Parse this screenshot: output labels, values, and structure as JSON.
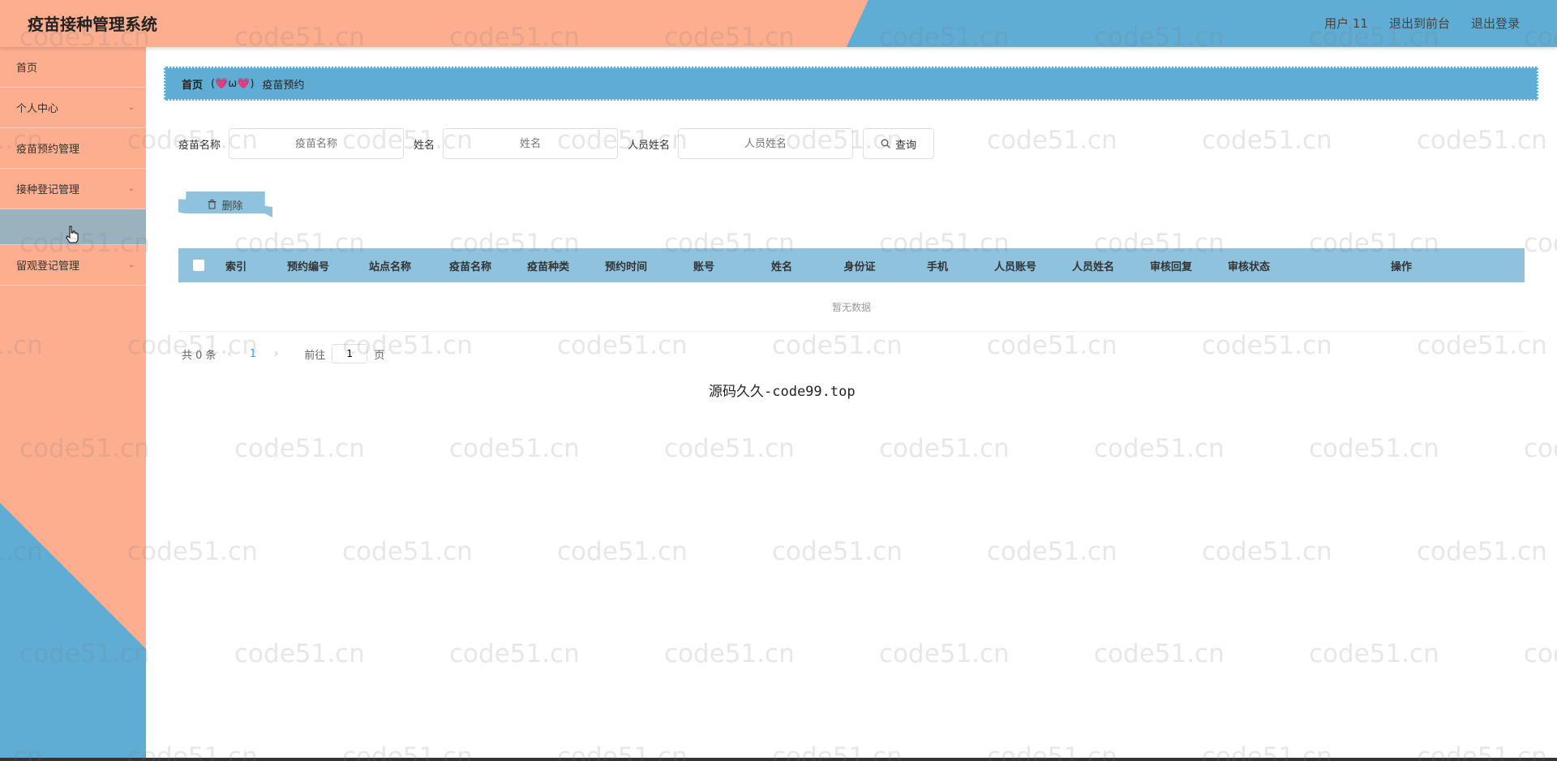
{
  "header": {
    "title": "疫苗接种管理系统",
    "user_label": "用户 11",
    "front_link": "退出到前台",
    "logout_link": "退出登录"
  },
  "sidebar": {
    "items": [
      {
        "label": "首页",
        "has_children": false
      },
      {
        "label": "个人中心",
        "has_children": true
      },
      {
        "label": "疫苗预约管理",
        "has_children": false
      },
      {
        "label": "接种登记管理",
        "has_children": true
      },
      {
        "label": "",
        "has_children": false
      },
      {
        "label": "留观登记管理",
        "has_children": true
      }
    ]
  },
  "breadcrumb": {
    "home": "首页",
    "separator": "(💗ω💗)",
    "current": "疫苗预约"
  },
  "search": {
    "vaccine_label": "疫苗名称",
    "vaccine_placeholder": "疫苗名称",
    "name_label": "姓名",
    "name_placeholder": "姓名",
    "person_label": "人员姓名",
    "person_placeholder": "人员姓名",
    "query_button": "查询"
  },
  "actions": {
    "delete_button": "删除"
  },
  "table": {
    "columns": [
      "索引",
      "预约编号",
      "站点名称",
      "疫苗名称",
      "疫苗种类",
      "预约时间",
      "账号",
      "姓名",
      "身份证",
      "手机",
      "人员账号",
      "人员姓名",
      "审核回复",
      "审核状态",
      "操作"
    ],
    "empty_text": "暂无数据"
  },
  "pagination": {
    "total": "共 0 条",
    "current_page": "1",
    "goto_label": "前往",
    "goto_value": "1",
    "page_suffix": "页"
  },
  "footer": {
    "text": "源码久久-code99.top"
  },
  "watermark": {
    "text": "code51.cn"
  },
  "colors": {
    "salmon": "#fdae8f",
    "blue": "#5fadd4",
    "table_header": "#8fc2dc"
  }
}
